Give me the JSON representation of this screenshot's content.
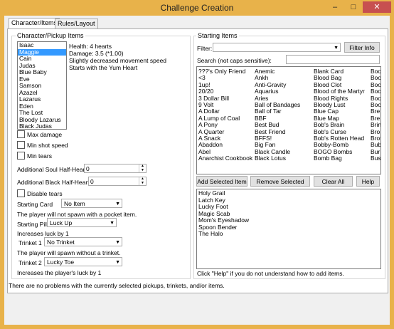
{
  "window": {
    "title": "Challenge Creation",
    "controls": [
      "–",
      "□",
      "✕"
    ]
  },
  "tabs": [
    {
      "label": "Character/Items"
    },
    {
      "label": "Rules/Layout"
    }
  ],
  "character_group": {
    "title": "Character/Pickup Items",
    "characters": [
      "Isaac",
      "Maggie",
      "Cain",
      "Judas",
      "Blue Baby",
      "Eve",
      "Samson",
      "Azazel",
      "Lazarus",
      "Eden",
      "The Lost",
      "Bloody Lazarus",
      "Black Judas"
    ],
    "selected": "Maggie",
    "info": [
      "Health: 4 hearts",
      "Damage: 3.5 (*1.00)",
      "Slightly decreased movement speed",
      "Starts with the Yum Heart"
    ],
    "max_damage": "Max damage",
    "min_shot_speed": "Min shot speed",
    "min_tears": "Min tears",
    "soul_label": "Additional Soul Half-Hearts",
    "soul_value": "0",
    "black_label": "Additional Black Half-Hearts",
    "black_value": "0",
    "disable_tears": "Disable tears",
    "card_label": "Starting Card",
    "card_value": "No Item",
    "card_note": "The player will not spawn with a pocket item.",
    "pill_label": "Starting Pill",
    "pill_value": "Luck Up",
    "pill_note": "Increases luck by 1",
    "trinket1_label": "Trinket 1",
    "trinket1_value": "No Trinket",
    "trinket1_note": "The player will spawn without a trinket.",
    "trinket2_label": "Trinket 2",
    "trinket2_value": "Lucky Toe",
    "trinket2_note": "Increases the player's luck by 1"
  },
  "starting_items": {
    "title": "Starting Items",
    "filter_label": "Filter:",
    "filter_info_button": "Filter Info",
    "search_label": "Search (not caps sensitive):",
    "columns": [
      [
        "???'s Only Friend",
        "<3",
        "1up!",
        "20/20",
        "3 Dollar Bill",
        "9 Volt",
        "A Dollar",
        "A Lump of Coal",
        "A Pony",
        "A Quarter",
        "A Snack",
        "Abaddon",
        "Abel",
        "Anarchist Cookbook"
      ],
      [
        "Anemic",
        "Ankh",
        "Anti-Gravity",
        "Aquarius",
        "Aries",
        "Ball of Bandages",
        "Ball of Tar",
        "BBF",
        "Best Bud",
        "Best Friend",
        "BFFS!",
        "Big Fan",
        "Black Candle",
        "Black Lotus"
      ],
      [
        "Blank Card",
        "Blood Bag",
        "Blood Clot",
        "Blood of the Martyr",
        "Blood Rights",
        "Bloody Lust",
        "Blue Cap",
        "Blue Map",
        "Bob's Brain",
        "Bob's Curse",
        "Bob's Rotten Head",
        "Bobby-Bomb",
        "BOGO Bombs",
        "Bomb Bag"
      ],
      [
        "Boo",
        "Boo",
        "Boo",
        "Boo",
        "Boo",
        "Boo",
        "Bre",
        "Bre",
        "Brin",
        "Bro",
        "Brot",
        "Bub",
        "Bur",
        "Bus"
      ]
    ],
    "add_button": "Add Selected Item",
    "remove_button": "Remove Selected Item",
    "clear_button": "Clear All Items",
    "help_button": "Help",
    "selected_items": [
      "Holy Grail",
      "Latch Key",
      "Lucky Foot",
      "Magic Scab",
      "Mom's Eyeshadow",
      "Spoon Bender",
      "The Halo"
    ],
    "hint": "Click \"Help\" if you do not understand how to add items."
  },
  "status": "There are no problems with the currently selected pickups, trinkets, and/or items.",
  "colors": {
    "title_bar": "#e8b24a",
    "selection": "#3399ff",
    "close": "#c75050"
  }
}
